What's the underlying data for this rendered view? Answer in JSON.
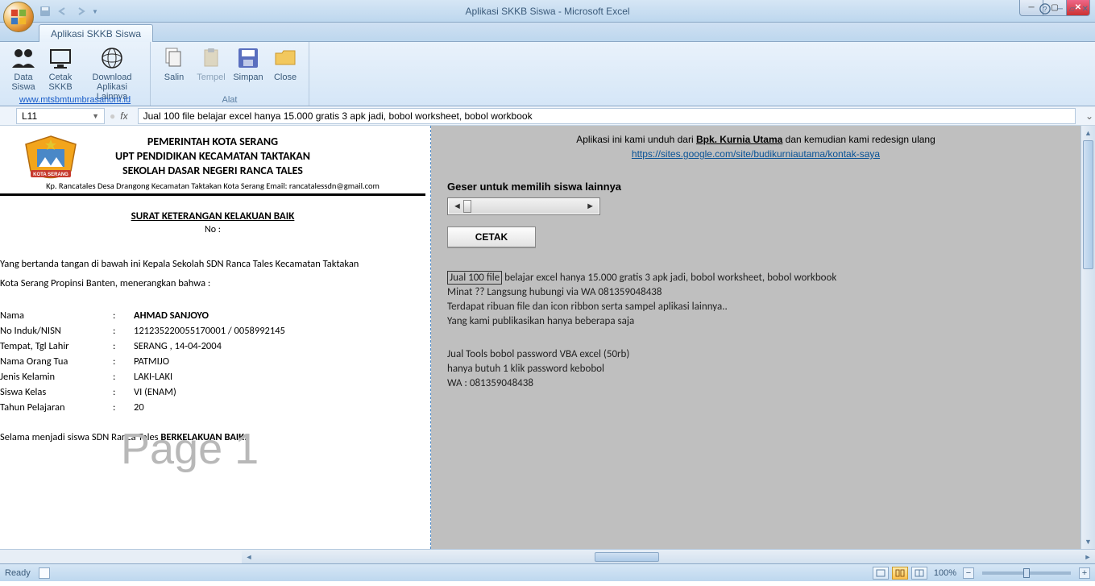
{
  "window": {
    "title": "Aplikasi SKKB Siswa - Microsoft Excel"
  },
  "tab": {
    "active": "Aplikasi SKKB Siswa"
  },
  "ribbon": {
    "group1_label": "www.mtsbmtumbrasanom.id",
    "data_siswa": "Data\nSiswa",
    "cetak_skkb": "Cetak\nSKKB",
    "download": "Download\nAplikasi Lainnya",
    "group2_label": "Alat",
    "salin": "Salin",
    "tempel": "Tempel",
    "simpan": "Simpan",
    "close": "Close"
  },
  "formula": {
    "cell_ref": "L11",
    "fx": "fx",
    "value": "Jual 100 file belajar excel hanya 15.000 gratis 3 apk jadi, bobol worksheet, bobol workbook"
  },
  "doc": {
    "gov1": "PEMERINTAH KOTA SERANG",
    "gov2": "UPT PENDIDIKAN KECAMATAN TAKTAKAN",
    "gov3": "SEKOLAH DASAR NEGERI RANCA TALES",
    "addr": "Kp. Rancatales Desa Drangong Kecamatan Taktakan Kota Serang Email: rancatalessdn@gmail.com",
    "title": "SURAT KETERANGAN KELAKUAN BAIK",
    "no": "No :",
    "para1": "Yang bertanda tangan di bawah ini Kepala Sekolah SDN Ranca Tales Kecamatan Taktakan",
    "para2": "Kota Serang Propinsi Banten, menerangkan bahwa :",
    "fields": {
      "nama_l": "Nama",
      "nama_v": "AHMAD SANJOYO",
      "nisn_l": "No Induk/NISN",
      "nisn_v": "121235220055170001 / 0058992145",
      "ttl_l": "Tempat, Tgl Lahir",
      "ttl_v": "SERANG , 14-04-2004",
      "ortu_l": "Nama Orang Tua",
      "ortu_v": "PATMIJO",
      "jk_l": "Jenis Kelamin",
      "jk_v": "LAKI-LAKI",
      "kls_l": "Siswa Kelas",
      "kls_v": "VI (ENAM)",
      "thn_l": "Tahun Pelajaran",
      "thn_v": "20"
    },
    "concl_a": "Selama menjadi siswa SDN Ranca Tales ",
    "concl_b": "BERKELAKUAN BAIK.",
    "watermark": "Page 1"
  },
  "side": {
    "info_a": "Aplikasi ini kami unduh dari ",
    "info_b": "Bpk. Kurnia Utama",
    "info_c": " dan kemudian kami redesign ulang",
    "link": "https://sites.google.com/site/budikurniautama/kontak-saya",
    "heading": "Geser untuk memilih siswa lainnya",
    "cetak": "CETAK",
    "jual1a": "Jual 100 file",
    "jual1b": " belajar excel hanya 15.000 gratis 3 apk jadi, bobol worksheet, bobol workbook",
    "jual2": "Minat ?? Langsung hubungi via WA 081359048438",
    "jual3": "Terdapat ribuan file dan icon ribbon serta sampel aplikasi lainnya..",
    "jual4": "Yang kami publikasikan hanya beberapa saja",
    "tools1": "Jual Tools bobol password VBA excel (50rb)",
    "tools2": "hanya butuh 1 klik password kebobol",
    "tools3": "WA : 081359048438"
  },
  "status": {
    "ready": "Ready",
    "zoom": "100%"
  }
}
